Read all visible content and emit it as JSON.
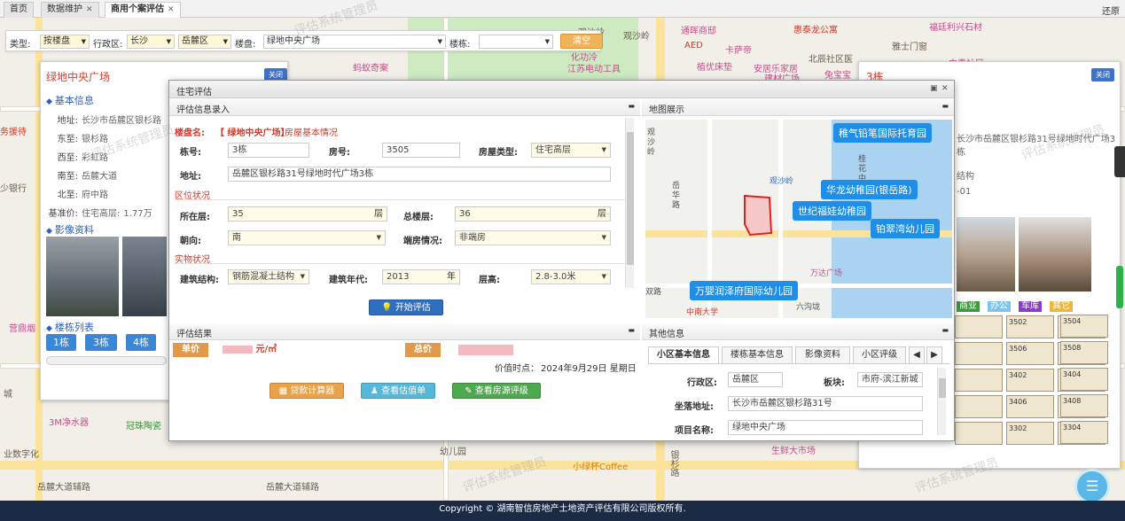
{
  "tabs": [
    {
      "label": "首页",
      "closable": false
    },
    {
      "label": "数据维护",
      "closable": true
    },
    {
      "label": "商用个案评估",
      "closable": true,
      "active": true
    }
  ],
  "restore_label": "还原",
  "filter": {
    "type_label": "类型:",
    "type_value": "按楼盘",
    "district_label": "行政区:",
    "city_value": "长沙",
    "district_value": "岳麓区",
    "estate_label": "楼盘:",
    "estate_value": "绿地中央广场",
    "building_label": "楼栋:",
    "building_value": "",
    "clear_label": "清空"
  },
  "map_labels": [
    "观沙岭",
    "惠泰龙公寓",
    "AED",
    "卡萨帝",
    "植优床垫",
    "安居乐家居",
    "建材广场",
    "兔宝宝",
    "北辰社区医",
    "雅士门窗",
    "福廷利兴石材",
    "化功冷",
    "江苏电动工具",
    "蚂蚁奇案",
    "务援待",
    "少银行",
    "营鼎烟",
    "城",
    "3M净水器",
    "冠珠陶瓷",
    "业数字化",
    "岳麓大道辅路",
    "岳麓大道辅路",
    "小绿杯Coffee",
    "银杉路",
    "生鲜大市场",
    "幼儿园",
    "观沙岭",
    "通晖商邸",
    "中青社区"
  ],
  "left_panel": {
    "title": "绿地中央广场",
    "close_label": "关闭",
    "basic_header": "基本信息",
    "rows": [
      {
        "k": "地址:",
        "v": "长沙市岳麓区银杉路"
      },
      {
        "k": "东至:",
        "v": "银杉路"
      },
      {
        "k": "西至:",
        "v": "彩虹路"
      },
      {
        "k": "南至:",
        "v": "岳麓大道"
      },
      {
        "k": "北至:",
        "v": "府中路"
      },
      {
        "k": "基准价:",
        "v": "住宅高层:"
      }
    ],
    "price_tail": "1.77万",
    "media_header": "影像资料",
    "buildings_header": "楼栋列表",
    "buildings": [
      "1栋",
      "3栋",
      "4栋"
    ]
  },
  "right_panel": {
    "title": "3栋",
    "close_label": "关闭",
    "address": "长沙市岳麓区银杉路31号绿地时代广场3栋",
    "structure": "结构",
    "code": "-01",
    "legend": [
      {
        "label": "商业",
        "color": "#3c9a3c"
      },
      {
        "label": "办公",
        "color": "#7fc4e8"
      },
      {
        "label": "车库",
        "color": "#8a3cc6"
      },
      {
        "label": "其它",
        "color": "#e8b840"
      }
    ],
    "units": [
      "3502",
      "3503",
      "3504",
      "3506",
      "3507",
      "3508",
      "3402",
      "3403",
      "3404",
      "3406",
      "3407",
      "3408",
      "3302",
      "3303",
      "3304"
    ],
    "partial": [
      "",
      "",
      "",
      "",
      ""
    ]
  },
  "dialog": {
    "title": "住宅评估",
    "input_header": "评估信息录入",
    "estate_name_label": "楼盘名:",
    "estate_name_value": "【 绿地中央广场】",
    "estate_sub": "房屋基本情况",
    "bld_no_label": "栋号:",
    "bld_no": "3栋",
    "room_no_label": "房号:",
    "room_no": "3505",
    "house_type_label": "房屋类型:",
    "house_type": "住宅高层",
    "addr_label": "地址:",
    "addr": "岳麓区银杉路31号绿地时代广场3栋",
    "area_section": "区位状况",
    "floor_label": "所在层:",
    "floor": "35",
    "floor_unit": "层",
    "total_floor_label": "总楼层:",
    "total_floor": "36",
    "total_floor_unit": "层",
    "orient_label": "朝向:",
    "orient": "南",
    "end_label": "端房情况:",
    "end_value": "非端房",
    "physical_section": "实物状况",
    "structure_label": "建筑结构:",
    "structure": "钢筋混凝土结构",
    "year_label": "建筑年代:",
    "year": "2013",
    "year_unit": "年",
    "height_label": "层高:",
    "height": "2.8-3.0米",
    "start_btn": "开始评估",
    "result_header": "评估结果",
    "unit_price_label": "单价",
    "unit_price_unit": "元/㎡",
    "total_label": "总价",
    "time_label": "价值时点：",
    "time_value": "2024年9月29日 星期日",
    "btn_loan": "贷款计算器",
    "btn_view": "查看估值单",
    "btn_rating": "查看房源评级",
    "map_header": "地图展示",
    "map_bubbles": [
      "稚气铅笔国际托育园",
      "华龙幼稚园(银岳路)",
      "世纪福娃幼稚园",
      "铂翠湾幼儿园",
      "万婴润泽府国际幼儿园"
    ],
    "map_labels": [
      "观沙岭",
      "岳华路",
      "万达广场",
      "中南大学",
      "双路",
      "六沟垅",
      "观沙岭",
      "桂花中路"
    ],
    "other_header": "其他信息",
    "other_tabs": [
      "小区基本信息",
      "楼栋基本信息",
      "影像资料",
      "小区评级"
    ],
    "district_label": "行政区:",
    "district": "岳麓区",
    "block_label": "板块:",
    "block": "市府-滨江新城",
    "location_label": "坐落地址:",
    "location": "长沙市岳麓区银杉路31号",
    "project_label": "项目名称:",
    "project": "绿地中央广场"
  },
  "watermark": "评估系统管理员",
  "footer": "Copyright © 湖南智信房地产土地资产评估有限公司版权所有."
}
